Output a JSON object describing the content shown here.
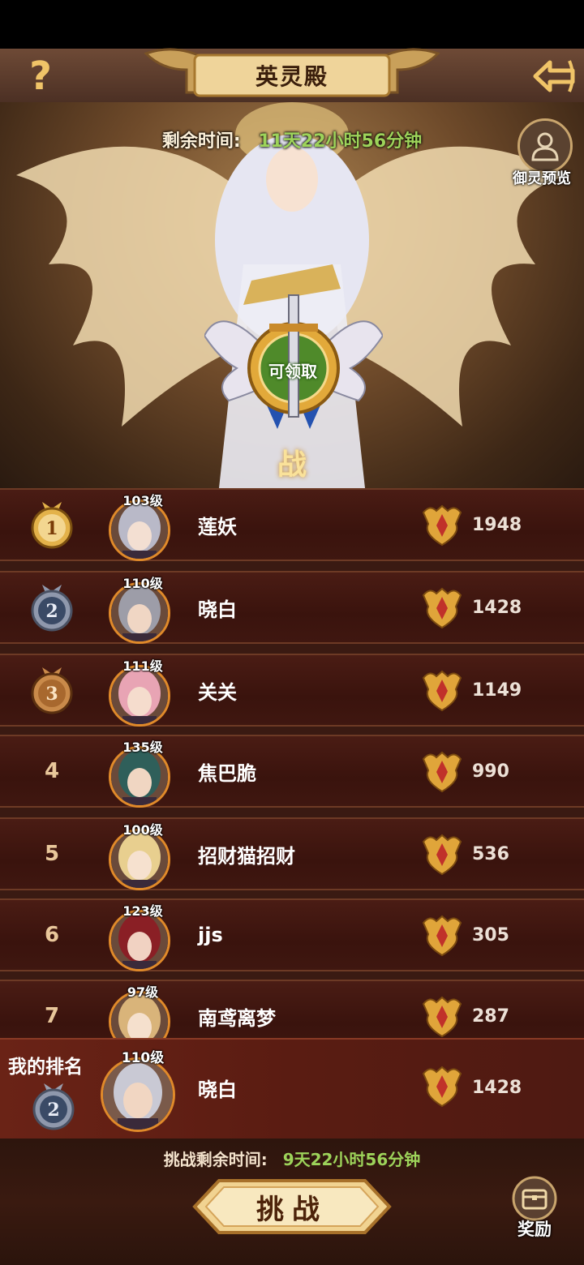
{
  "header": {
    "help_label": "?",
    "title": "英灵殿"
  },
  "banner": {
    "timer_label": "剩余时间:",
    "timer_value": "11天22小时56分钟",
    "preview_label": "御灵预览",
    "claim_label": "可领取",
    "battle_order_label": "战令"
  },
  "ranks": [
    {
      "rank": "1",
      "level": "103级",
      "name": "莲妖",
      "score": "1948"
    },
    {
      "rank": "2",
      "level": "110级",
      "name": "晓白",
      "score": "1428"
    },
    {
      "rank": "3",
      "level": "111级",
      "name": "关关",
      "score": "1149"
    },
    {
      "rank": "4",
      "level": "135级",
      "name": "焦巴脆",
      "score": "990"
    },
    {
      "rank": "5",
      "level": "100级",
      "name": "招财猫招财",
      "score": "536"
    },
    {
      "rank": "6",
      "level": "123级",
      "name": "jjs",
      "score": "305"
    },
    {
      "rank": "7",
      "level": "97级",
      "name": "南鸢离梦",
      "score": "287"
    }
  ],
  "my_rank": {
    "label": "我的排名",
    "rank": "2",
    "level": "110级",
    "name": "晓白",
    "score": "1428"
  },
  "footer": {
    "challenge_timer_label": "挑战剩余时间:",
    "challenge_timer_value": "9天22小时56分钟",
    "challenge_button": "挑战",
    "reward_label": "奖励"
  },
  "colors": {
    "accent_gold": "#f0c468",
    "timer_green": "#9dd35a",
    "row_bg": "#3a130d",
    "my_rank_bg": "#5a1c12"
  }
}
